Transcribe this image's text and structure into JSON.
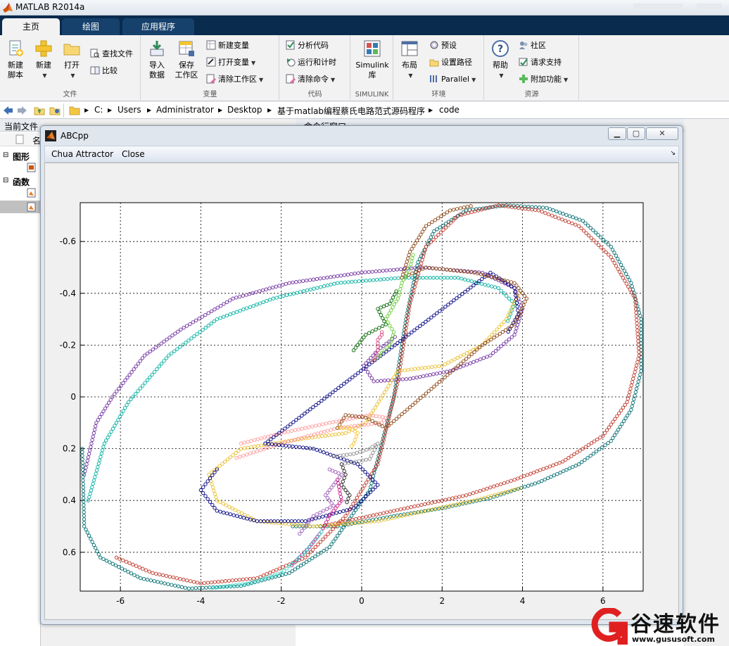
{
  "app": {
    "title": "MATLAB R2014a"
  },
  "tabs": [
    {
      "label": "主页",
      "active": true
    },
    {
      "label": "绘图",
      "active": false
    },
    {
      "label": "应用程序",
      "active": false
    }
  ],
  "ribbon": {
    "file": {
      "label": "文件",
      "new_script_l1": "新建",
      "new_script_l2": "脚本",
      "new": "新建",
      "open": "打开",
      "find_files": "查找文件",
      "compare": "比较"
    },
    "variable": {
      "label": "变量",
      "import_l1": "导入",
      "import_l2": "数据",
      "save_l1": "保存",
      "save_l2": "工作区",
      "new_variable": "新建变量",
      "open_variable": "打开变量",
      "clear_workspace": "清除工作区"
    },
    "code": {
      "label": "代码",
      "analyze": "分析代码",
      "run_time": "运行和计时",
      "clear_commands": "清除命令"
    },
    "simulink": {
      "label": "SIMULINK",
      "btn_l1": "Simulink",
      "btn_l2": "库"
    },
    "environment": {
      "label": "环境",
      "layout": "布局",
      "preferences": "预设",
      "set_path": "设置路径",
      "parallel": "Parallel"
    },
    "resources": {
      "label": "资源",
      "help": "帮助",
      "community": "社区",
      "support": "请求支持",
      "addons": "附加功能"
    }
  },
  "address": [
    "C:",
    "Users",
    "Administrator",
    "Desktop",
    "基于matlab编程蔡氏电路范式源码程序",
    "code"
  ],
  "left_panel": {
    "header": "当前文件夹",
    "col_name": "名",
    "section_figures": "图形",
    "section_functions": "函数"
  },
  "right_panel": {
    "header": "命令行窗口"
  },
  "figure": {
    "title": "ABCpp",
    "menu": [
      "Chua Attractor",
      "Close"
    ]
  },
  "chart_data": {
    "type": "scatter",
    "xlim": [
      -7,
      7
    ],
    "ylim": [
      -0.75,
      0.75
    ],
    "y_reversed": true,
    "grid": true,
    "x_ticks": [
      -6,
      -4,
      -2,
      0,
      2,
      4,
      6
    ],
    "y_ticks": [
      -0.6,
      -0.4,
      -0.2,
      0,
      0.2,
      0.4,
      0.6
    ],
    "x_tick_labels": [
      "-6",
      "-4",
      "-2",
      "0",
      "2",
      "4",
      "6"
    ],
    "y_tick_labels": [
      "-0.6",
      "-0.4",
      "-0.2",
      "0",
      "0.2",
      "0.4",
      "0.6"
    ],
    "marker": "open-circle",
    "series": [
      {
        "color": "#7030a0",
        "points": [
          [
            -6.9,
            0.3
          ],
          [
            -6.6,
            0.1
          ],
          [
            -6.2,
            0.0
          ],
          [
            -5.4,
            -0.16
          ],
          [
            -4.5,
            -0.26
          ],
          [
            -3.2,
            -0.38
          ],
          [
            -1.8,
            -0.44
          ],
          [
            0,
            -0.48
          ],
          [
            1.5,
            -0.5
          ],
          [
            3,
            -0.48
          ],
          [
            3.8,
            -0.42
          ],
          [
            4.0,
            -0.34
          ],
          [
            3.8,
            -0.24
          ],
          [
            3.2,
            -0.16
          ],
          [
            2.2,
            -0.1
          ],
          [
            1.2,
            -0.07
          ],
          [
            0.3,
            -0.06
          ],
          [
            0.05,
            -0.12
          ],
          [
            0.4,
            -0.18
          ],
          [
            0.9,
            -0.24
          ]
        ]
      },
      {
        "color": "#00b0a0",
        "points": [
          [
            -6.8,
            0.4
          ],
          [
            -6.4,
            0.18
          ],
          [
            -5.8,
            0.02
          ],
          [
            -4.8,
            -0.16
          ],
          [
            -3.6,
            -0.3
          ],
          [
            -2.2,
            -0.38
          ],
          [
            -0.6,
            -0.44
          ],
          [
            1.0,
            -0.46
          ],
          [
            2.4,
            -0.46
          ],
          [
            3.4,
            -0.42
          ],
          [
            3.8,
            -0.36
          ],
          [
            3.6,
            -0.28
          ]
        ]
      },
      {
        "color": "#006d70",
        "points": [
          [
            -6.95,
            0.2
          ],
          [
            -6.9,
            0.5
          ],
          [
            -6.5,
            0.62
          ],
          [
            -5.5,
            0.7
          ],
          [
            -4.3,
            0.74
          ],
          [
            -3.0,
            0.73
          ],
          [
            -1.8,
            0.68
          ],
          [
            -0.8,
            0.58
          ],
          [
            0.2,
            0.36
          ],
          [
            0.8,
            0.0
          ],
          [
            1.1,
            -0.3
          ],
          [
            1.4,
            -0.52
          ],
          [
            1.8,
            -0.64
          ],
          [
            2.6,
            -0.72
          ],
          [
            3.6,
            -0.74
          ],
          [
            4.6,
            -0.73
          ],
          [
            5.5,
            -0.68
          ],
          [
            6.2,
            -0.58
          ],
          [
            6.7,
            -0.44
          ],
          [
            6.95,
            -0.3
          ],
          [
            6.95,
            -0.1
          ],
          [
            6.7,
            0.05
          ],
          [
            6.2,
            0.17
          ],
          [
            5.4,
            0.26
          ],
          [
            4.4,
            0.33
          ],
          [
            3.2,
            0.39
          ],
          [
            2.0,
            0.43
          ],
          [
            0.8,
            0.46
          ],
          [
            -0.6,
            0.5
          ],
          [
            -1.8,
            0.5
          ]
        ]
      },
      {
        "color": "#c0392b",
        "points": [
          [
            -6.1,
            0.62
          ],
          [
            -5.2,
            0.68
          ],
          [
            -4.0,
            0.72
          ],
          [
            -2.6,
            0.7
          ],
          [
            -1.4,
            0.62
          ],
          [
            -0.4,
            0.46
          ],
          [
            0.4,
            0.26
          ],
          [
            0.9,
            -0.06
          ],
          [
            1.2,
            -0.36
          ],
          [
            1.6,
            -0.58
          ],
          [
            2.4,
            -0.7
          ],
          [
            3.4,
            -0.74
          ],
          [
            4.4,
            -0.72
          ],
          [
            5.4,
            -0.66
          ],
          [
            6.2,
            -0.54
          ],
          [
            6.8,
            -0.38
          ],
          [
            6.9,
            -0.16
          ],
          [
            6.6,
            0.02
          ],
          [
            6.0,
            0.15
          ],
          [
            5.0,
            0.25
          ],
          [
            3.8,
            0.32
          ],
          [
            2.6,
            0.38
          ],
          [
            1.4,
            0.42
          ],
          [
            0.2,
            0.46
          ],
          [
            -1.0,
            0.5
          ]
        ]
      },
      {
        "color": "#e8c030",
        "points": [
          [
            3.9,
            -0.4
          ],
          [
            3.6,
            -0.3
          ],
          [
            3.0,
            -0.2
          ],
          [
            2.0,
            -0.12
          ],
          [
            0.9,
            -0.1
          ],
          [
            0.1,
            0.1
          ],
          [
            -0.4,
            0.14
          ],
          [
            -1.4,
            0.16
          ],
          [
            -3.0,
            0.2
          ],
          [
            -3.8,
            0.3
          ],
          [
            -3.6,
            0.4
          ],
          [
            -2.6,
            0.48
          ],
          [
            -1.2,
            0.5
          ],
          [
            0.4,
            0.48
          ],
          [
            1.6,
            0.44
          ],
          [
            2.8,
            0.4
          ],
          [
            4.0,
            0.35
          ]
        ]
      },
      {
        "color": "#ff9999",
        "points": [
          [
            -3.0,
            0.18
          ],
          [
            -2.0,
            0.14
          ],
          [
            -0.8,
            0.1
          ],
          [
            0.2,
            0.07
          ],
          [
            0.6,
            0.08
          ],
          [
            0.5,
            0.1
          ],
          [
            -0.6,
            0.12
          ],
          [
            -2.0,
            0.18
          ],
          [
            -3.2,
            0.24
          ]
        ]
      },
      {
        "color": "#000080",
        "points": [
          [
            -3.6,
            0.28
          ],
          [
            -4.0,
            0.36
          ],
          [
            -3.6,
            0.44
          ],
          [
            -2.6,
            0.48
          ],
          [
            -1.4,
            0.48
          ],
          [
            -0.2,
            0.43
          ],
          [
            0.4,
            0.34
          ],
          [
            -0.1,
            0.26
          ],
          [
            -1.2,
            0.2
          ],
          [
            -2.4,
            0.18
          ],
          [
            3.2,
            -0.48
          ],
          [
            3.8,
            -0.42
          ],
          [
            3.9,
            -0.32
          ],
          [
            3.6,
            -0.24
          ]
        ]
      },
      {
        "color": "#8b4513",
        "points": [
          [
            -0.6,
            0.12
          ],
          [
            -0.4,
            0.07
          ],
          [
            0.1,
            0.08
          ],
          [
            0.6,
            0.12
          ],
          [
            3.0,
            -0.2
          ],
          [
            3.8,
            -0.28
          ],
          [
            4.1,
            -0.38
          ],
          [
            3.8,
            -0.44
          ],
          [
            2.8,
            -0.48
          ],
          [
            1.6,
            -0.5
          ],
          [
            1.0,
            -0.46
          ],
          [
            1.2,
            -0.56
          ],
          [
            1.6,
            -0.66
          ],
          [
            2.2,
            -0.72
          ],
          [
            2.8,
            -0.74
          ]
        ]
      },
      {
        "color": "#66cc33",
        "points": [
          [
            0.3,
            -0.14
          ],
          [
            0.7,
            -0.2
          ],
          [
            0.8,
            -0.25
          ],
          [
            0.6,
            -0.3
          ],
          [
            0.9,
            -0.38
          ],
          [
            1.0,
            -0.44
          ],
          [
            1.2,
            -0.5
          ],
          [
            1.3,
            -0.56
          ]
        ]
      },
      {
        "color": "#006400",
        "points": [
          [
            -0.2,
            -0.18
          ],
          [
            0.1,
            -0.24
          ],
          [
            0.6,
            -0.28
          ],
          [
            0.4,
            -0.34
          ],
          [
            0.7,
            -0.36
          ],
          [
            0.9,
            -0.42
          ]
        ]
      },
      {
        "color": "#d8407a",
        "points": [
          [
            0.3,
            -0.14
          ],
          [
            0.4,
            -0.18
          ],
          [
            0.4,
            -0.22
          ],
          [
            0.5,
            -0.24
          ],
          [
            0.5,
            -0.26
          ]
        ]
      },
      {
        "color": "#f4c430",
        "points": [
          [
            -0.55,
            0.12
          ],
          [
            -0.3,
            0.12
          ],
          [
            -0.1,
            0.14
          ],
          [
            -0.2,
            0.18
          ],
          [
            -0.3,
            0.2
          ]
        ]
      },
      {
        "color": "#909090",
        "points": [
          [
            -0.7,
            0.23
          ],
          [
            -0.2,
            0.22
          ],
          [
            0.2,
            0.2
          ],
          [
            0.4,
            0.18
          ],
          [
            0.2,
            0.24
          ],
          [
            -0.5,
            0.26
          ]
        ]
      },
      {
        "color": "#202020",
        "points": [
          [
            -0.5,
            0.26
          ],
          [
            -0.4,
            0.3
          ],
          [
            -0.5,
            0.34
          ],
          [
            -0.3,
            0.38
          ],
          [
            -0.4,
            0.42
          ]
        ]
      },
      {
        "color": "#9b59b6",
        "points": [
          [
            -0.8,
            0.28
          ],
          [
            -0.5,
            0.3
          ],
          [
            -0.7,
            0.34
          ],
          [
            -0.9,
            0.38
          ],
          [
            -0.7,
            0.42
          ],
          [
            -1.2,
            0.46
          ],
          [
            -1.6,
            0.54
          ]
        ]
      },
      {
        "color": "#c71585",
        "points": [
          [
            -0.6,
            0.32
          ],
          [
            -0.5,
            0.4
          ],
          [
            -0.8,
            0.46
          ],
          [
            -1.0,
            0.52
          ],
          [
            -1.3,
            0.58
          ],
          [
            -1.8,
            0.66
          ]
        ]
      },
      {
        "color": "#40e0d0",
        "points": [
          [
            -1.0,
            0.52
          ],
          [
            -1.4,
            0.6
          ],
          [
            -2.0,
            0.68
          ],
          [
            -2.8,
            0.72
          ],
          [
            -3.8,
            0.74
          ]
        ]
      }
    ]
  }
}
